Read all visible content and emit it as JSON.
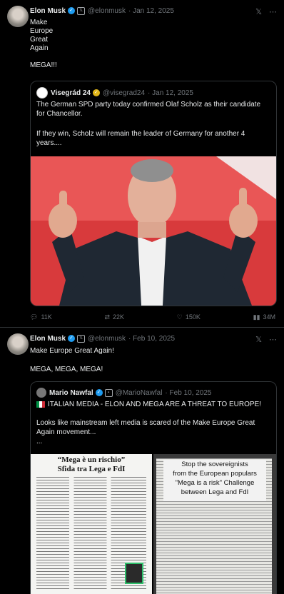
{
  "tweets": [
    {
      "author": "Elon Musk",
      "handle": "@elonmusk",
      "date": "· Jan 12, 2025",
      "text_lines": [
        "Make",
        "Europe",
        "Great",
        "Again",
        "",
        "MEGA!!!"
      ],
      "quote": {
        "author": "Visegrád 24",
        "handle": "@visegrad24",
        "date": "· Jan 12, 2025",
        "text": "The German SPD party today confirmed Olaf Scholz as their candidate for  Chancellor.",
        "text2": "If they win, Scholz will remain the leader of Germany for another 4 years...."
      },
      "actions": {
        "replies": "11K",
        "reposts": "22K",
        "likes": "150K",
        "views": "34M"
      }
    },
    {
      "author": "Elon Musk",
      "handle": "@elonmusk",
      "date": "· Feb 10, 2025",
      "text1": "Make Europe Great Again!",
      "text2": "MEGA, MEGA, MEGA!",
      "quote": {
        "author": "Mario Nawfal",
        "handle": "@MarioNawfal",
        "date": "· Feb 10, 2025",
        "line1": "ITALIAN MEDIA - ELON AND MEGA ARE A THREAT TO EUROPE!",
        "line2": "Looks like mainstream left media is scared of the Make Europe Great Again movement...",
        "line3": "...",
        "img1_title1": "“Mega è un rischio”",
        "img1_title2": "Sfida tra Lega e FdI",
        "img2_lines": [
          "Stop the sovereignists",
          "from the European populars",
          "\"Mega is a risk\" Challenge",
          "between Lega and FdI"
        ]
      }
    }
  ],
  "colors": {
    "bg": "#000000",
    "text": "#e7e9ea",
    "muted": "#71767b",
    "border": "#2f3336",
    "verified": "#1d9bf0",
    "gold": "#e2b719"
  },
  "icons": [
    "x-logo-icon",
    "more-icon",
    "reply-icon",
    "repost-icon",
    "like-icon",
    "views-icon"
  ]
}
